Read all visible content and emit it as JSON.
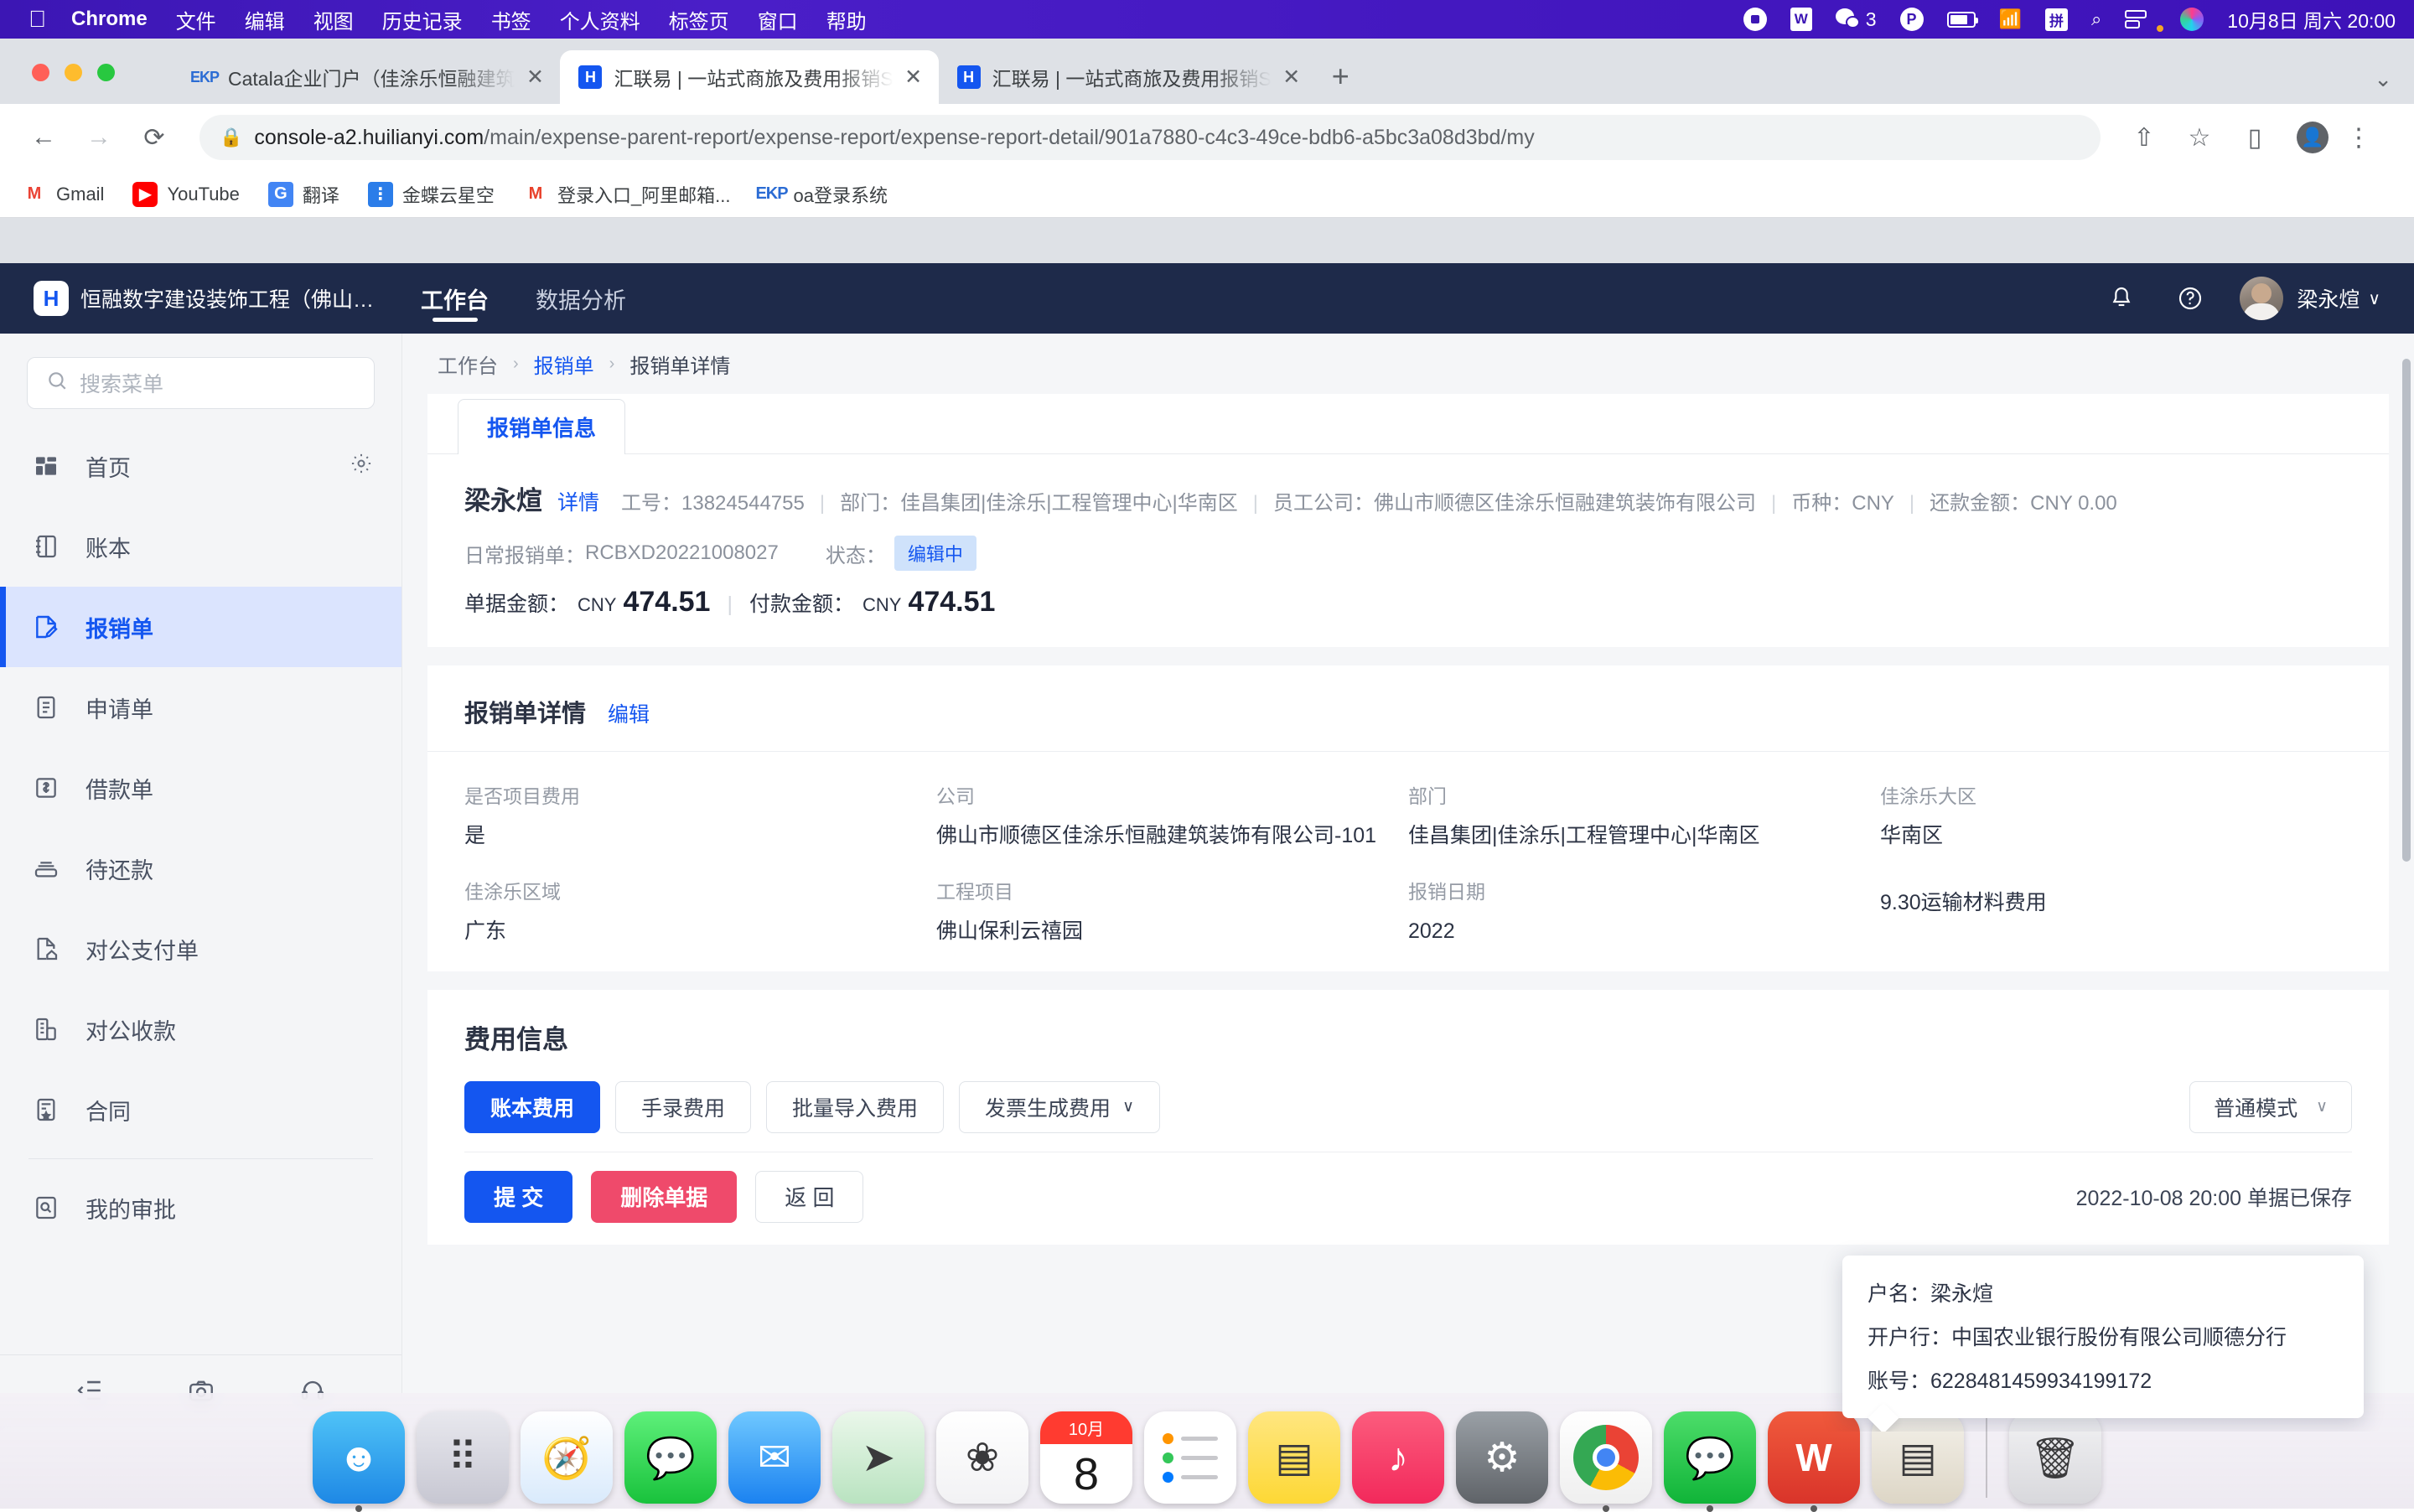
{
  "macos": {
    "menus": [
      "Chrome",
      "文件",
      "编辑",
      "视图",
      "历史记录",
      "书签",
      "个人资料",
      "标签页",
      "窗口",
      "帮助"
    ],
    "apple_glyph": "",
    "wps_glyph": "W",
    "pinyin_glyph": "拼",
    "p_glyph": "P",
    "wechat_badge": "3",
    "search_glyph": "⌕",
    "clock": "10月8日 周六  20:00"
  },
  "browser": {
    "tabs": [
      {
        "title": "Catala企业门户（佳涂乐恒融建筑",
        "favicon": "ekp-icon",
        "favicon_text": "EKP",
        "active": false
      },
      {
        "title": "汇联易 | 一站式商旅及费用报销S",
        "favicon": "huilianyi-icon",
        "favicon_text": "H",
        "active": true
      },
      {
        "title": "汇联易 | 一站式商旅及费用报销S",
        "favicon": "huilianyi-icon",
        "favicon_text": "H",
        "active": false
      }
    ],
    "new_tab_label": "+",
    "tabstrip_expand": "⌄",
    "back_icon": "←",
    "forward_icon": "→",
    "reload_icon": "⟳",
    "lock_icon": "🔒",
    "url_domain": "console-a2.huilianyi.com",
    "url_path": "/main/expense-parent-report/expense-report/expense-report-detail/901a7880-c4c3-49ce-bdb6-a5bc3a08d3bd/my",
    "share_icon": "⇧",
    "bookmark_star_icon": "☆",
    "sidepanel_icon": "▯",
    "profile_icon": "👤",
    "menu_icon": "⋮",
    "bookmarks": [
      {
        "label": "Gmail",
        "icon": "gmail-icon",
        "glyph": "M"
      },
      {
        "label": "YouTube",
        "icon": "youtube-icon",
        "glyph": "▶"
      },
      {
        "label": "翻译",
        "icon": "translate-icon",
        "glyph": "G"
      },
      {
        "label": "金蝶云星空",
        "icon": "kingdee-icon",
        "glyph": "⋮"
      },
      {
        "label": "登录入口_阿里邮箱...",
        "icon": "mail-icon",
        "glyph": "M"
      },
      {
        "label": "oa登录系统",
        "icon": "ekp-icon",
        "glyph": "EKP"
      }
    ]
  },
  "app_header": {
    "logo_text": "H",
    "org_name": "恒融数字建设装饰工程（佛山…",
    "nav_tabs": [
      {
        "label": "工作台",
        "active": true
      },
      {
        "label": "数据分析",
        "active": false
      }
    ],
    "bell_icon": "🔔",
    "help_icon": "?",
    "user_name": "梁永煊",
    "caret": "∨"
  },
  "sidebar": {
    "search_placeholder": "搜索菜单",
    "search_icon": "⌕",
    "items": [
      {
        "label": "首页",
        "icon": "dashboard-icon",
        "active": false,
        "has_gear": true
      },
      {
        "label": "账本",
        "icon": "ledger-icon",
        "active": false,
        "has_gear": false
      },
      {
        "label": "报销单",
        "icon": "expense-report-icon",
        "active": true,
        "has_gear": false
      },
      {
        "label": "申请单",
        "icon": "application-icon",
        "active": false,
        "has_gear": false
      },
      {
        "label": "借款单",
        "icon": "loan-icon",
        "active": false,
        "has_gear": false
      },
      {
        "label": "待还款",
        "icon": "repayment-icon",
        "active": false,
        "has_gear": false
      },
      {
        "label": "对公支付单",
        "icon": "corporate-payment-icon",
        "active": false,
        "has_gear": false
      },
      {
        "label": "对公收款",
        "icon": "corporate-receipt-icon",
        "active": false,
        "has_gear": false
      },
      {
        "label": "合同",
        "icon": "contract-icon",
        "active": false,
        "has_gear": false
      },
      {
        "label": "我的审批",
        "icon": "my-approval-icon",
        "active": false,
        "has_gear": false
      }
    ],
    "gear_icon": "⚙",
    "bottom_icons": [
      "collapse-icon",
      "camera-icon",
      "headset-icon"
    ]
  },
  "breadcrumb": {
    "items": [
      "工作台",
      "报销单",
      "报销单详情"
    ],
    "separator": "›"
  },
  "report": {
    "tab_label": "报销单信息",
    "user_name": "梁永煊",
    "detail_link": "详情",
    "employee_no_label": "工号：",
    "employee_no": "13824544755",
    "department_label": "部门：",
    "department": "佳昌集团|佳涂乐|工程管理中心|华南区",
    "company_label": "员工公司：",
    "company": "佛山市顺德区佳涂乐恒融建筑装饰有限公司",
    "currency_label": "币种：",
    "currency": "CNY",
    "repay_label": "还款金额：",
    "repay_amount": "CNY 0.00",
    "doc_type_label": "日常报销单：",
    "doc_no": "RCBXD20221008027",
    "status_label": "状态：",
    "status": "编辑中",
    "doc_amount_label": "单据金额：",
    "doc_amount_currency": "CNY",
    "doc_amount": "474.51",
    "pay_amount_label": "付款金额：",
    "pay_amount_currency": "CNY",
    "pay_amount": "474.51"
  },
  "detail_section": {
    "title": "报销单详情",
    "edit_label": "编辑",
    "fields_row1": [
      {
        "label": "是否项目费用",
        "value": "是"
      },
      {
        "label": "公司",
        "value": "佛山市顺德区佳涂乐恒融建筑装饰有限公司-101"
      },
      {
        "label": "部门",
        "value": "佳昌集团|佳涂乐|工程管理中心|华南区"
      },
      {
        "label": "佳涂乐大区",
        "value": "华南区"
      }
    ],
    "fields_row2": [
      {
        "label": "佳涂乐区域",
        "value": "广东"
      },
      {
        "label": "工程项目",
        "value": "佛山保利云禧园"
      },
      {
        "label": "报销日期",
        "value": "2022"
      },
      {
        "label": "",
        "value": "9.30运输材料费用"
      }
    ]
  },
  "tooltip": {
    "lines": [
      "户名：梁永煊",
      "开户行：中国农业银行股份有限公司顺德分行",
      "账号：6228481459934199172"
    ]
  },
  "fee_section": {
    "title": "费用信息",
    "buttons": [
      {
        "label": "账本费用",
        "primary": true,
        "has_caret": false
      },
      {
        "label": "手录费用",
        "primary": false,
        "has_caret": false
      },
      {
        "label": "批量导入费用",
        "primary": false,
        "has_caret": false
      },
      {
        "label": "发票生成费用",
        "primary": false,
        "has_caret": true
      }
    ],
    "mode_label": "普通模式",
    "mode_caret": "∨",
    "caret": "∨"
  },
  "actions": {
    "submit": "提 交",
    "delete": "删除单据",
    "back": "返 回",
    "saved_text": "2022-10-08 20:00 单据已保存"
  },
  "dock": {
    "items": [
      {
        "name": "finder",
        "glyph": "☻",
        "bg": "linear-gradient(180deg,#4fc3f7,#1e88e5)",
        "running": true
      },
      {
        "name": "launchpad",
        "glyph": "⠿",
        "bg": "linear-gradient(180deg,#e8e8ee,#c7c7d2)",
        "running": false
      },
      {
        "name": "safari",
        "glyph": "🧭",
        "bg": "linear-gradient(180deg,#ffffff,#d9eafc)",
        "running": false
      },
      {
        "name": "messages",
        "glyph": "💬",
        "bg": "linear-gradient(180deg,#5ef07a,#19c23c)",
        "running": false
      },
      {
        "name": "mail",
        "glyph": "✉",
        "bg": "linear-gradient(180deg,#6fc8ff,#1b82f0)",
        "running": false
      },
      {
        "name": "maps",
        "glyph": "➤",
        "bg": "linear-gradient(180deg,#eaf7ea,#b9e3c0)",
        "running": false
      },
      {
        "name": "photos",
        "glyph": "❀",
        "bg": "linear-gradient(180deg,#ffffff,#f2f2f4)",
        "running": false
      },
      {
        "name": "calendar",
        "glyph": "8",
        "bg": "#ffffff",
        "running": false,
        "month": "10月"
      },
      {
        "name": "reminders",
        "glyph": "☰",
        "bg": "#ffffff",
        "running": false
      },
      {
        "name": "notes",
        "glyph": "▤",
        "bg": "linear-gradient(180deg,#ffe680,#fdd835)",
        "running": false
      },
      {
        "name": "music",
        "glyph": "♪",
        "bg": "linear-gradient(180deg,#fc5c7d,#f2295b)",
        "running": false
      },
      {
        "name": "system-settings",
        "glyph": "⚙",
        "bg": "linear-gradient(180deg,#9aa0a6,#5f6368)",
        "running": false
      },
      {
        "name": "chrome",
        "glyph": "◉",
        "bg": "linear-gradient(180deg,#ffffff,#efefef)",
        "running": true
      },
      {
        "name": "wechat",
        "glyph": "💬",
        "bg": "linear-gradient(180deg,#4ddd6a,#10b438)",
        "running": true
      },
      {
        "name": "wps",
        "glyph": "W",
        "bg": "linear-gradient(180deg,#f05a3c,#d9342a)",
        "running": true
      },
      {
        "name": "pdf-folder",
        "glyph": "▤",
        "bg": "linear-gradient(180deg,#f4f1ea,#ddd6c6)",
        "running": false
      },
      {
        "name": "trash",
        "glyph": "🗑",
        "bg": "linear-gradient(180deg,#f2f2f4,#d8d8dc)",
        "running": false
      }
    ]
  }
}
